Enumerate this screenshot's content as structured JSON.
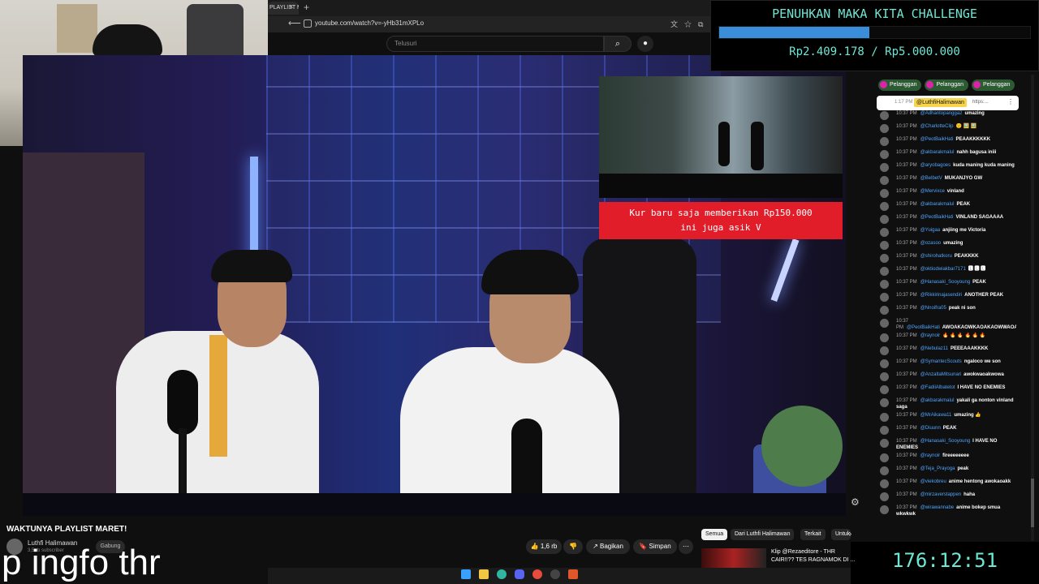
{
  "browser": {
    "tab_label": "PLAYLIST M",
    "tab_close": "×",
    "new_tab": "+",
    "url": "youtube.com/watch?v=-yHb31mXPLo",
    "icons": [
      "translate-icon",
      "star-icon",
      "extensions-icon"
    ]
  },
  "youtube": {
    "search_placeholder": "Telusuri",
    "search_icon": "⌕",
    "mic_icon": "🎤"
  },
  "challenge": {
    "title": "PENUHKAN MAKA KITA CHALLENGE",
    "progress_fraction": 0.4818,
    "amount": "Rp2.409.178 / Rp5.000.000",
    "bar_color": "#3a8ed9",
    "text_color": "#6ee7d4"
  },
  "donation": {
    "line1": "Kur baru saja memberikan Rp150.000",
    "line2": "ini juga asik V",
    "bg_color": "#e21d2a"
  },
  "chat": {
    "sub_buttons": [
      "Pelanggan",
      "Pelanggan",
      "Pelanggan"
    ],
    "pinned": {
      "time": "1:17 PM",
      "user": "@LuthfiHalimawan",
      "text": "https:..."
    },
    "messages": [
      {
        "time": "10:37 PM",
        "user": "@Adhantopangga2",
        "text": "umazing"
      },
      {
        "time": "10:37 PM",
        "user": "@CharlotteClip",
        "text": "🙂 🖼️ 🖼️"
      },
      {
        "time": "10:37 PM",
        "user": "@PeotBaikHati",
        "text": "PEAAKKKKKK"
      },
      {
        "time": "10:37 PM",
        "user": "@akbarakmalul",
        "text": "nahh bagusa iniii"
      },
      {
        "time": "10:37 PM",
        "user": "@aryobagoes",
        "text": "kuda maning kuda maning"
      },
      {
        "time": "10:37 PM",
        "user": "@BelbetV",
        "text": "MUKANJYO GW"
      },
      {
        "time": "10:37 PM",
        "user": "@Mervixce",
        "text": "vinland"
      },
      {
        "time": "10:37 PM",
        "user": "@akbarakmalul",
        "text": "PEAK"
      },
      {
        "time": "10:37 PM",
        "user": "@PeotBaikHati",
        "text": "VINLAND SAGAAAA"
      },
      {
        "time": "10:37 PM",
        "user": "@Yuigaa",
        "text": "anjiing me Victoria"
      },
      {
        "time": "10:37 PM",
        "user": "@ozasoo",
        "text": "umazing"
      },
      {
        "time": "10:37 PM",
        "user": "@shirohatkoru",
        "text": "PEAKKKK"
      },
      {
        "time": "10:37 PM",
        "user": "@oktiodwiakbar7171",
        "text": "🅻 🅻 🅻"
      },
      {
        "time": "10:37 PM",
        "user": "@Hanasaki_Sooyoung",
        "text": "PEAK"
      },
      {
        "time": "10:37 PM",
        "user": "@Rikkirinajasendiri",
        "text": "ANOTHER PEAK"
      },
      {
        "time": "10:37 PM",
        "user": "@Nnoifra05",
        "text": "peak ni son"
      },
      {
        "time": "10:37 PM",
        "user": "@PeotBaikHati",
        "text": "AWOAKAOWKAOAKAOWWAOAKAOAKA"
      },
      {
        "time": "10:37 PM",
        "user": "@raynoir",
        "text": "🔥 🔥 🔥 🔥 🔥 🔥"
      },
      {
        "time": "10:37 PM",
        "user": "@Nebulaz11",
        "text": "PEEEAAAKKKK"
      },
      {
        "time": "10:37 PM",
        "user": "@SymantecScouts",
        "text": "ngaloco we son"
      },
      {
        "time": "10:37 PM",
        "user": "@AnzaltaMitsunari",
        "text": "awokwaoakwowa"
      },
      {
        "time": "10:37 PM",
        "user": "@FadilAlbatetot",
        "text": "I HAVE NO ENEMIES"
      },
      {
        "time": "10:37 PM",
        "user": "@akbarakmalul",
        "text": "yakali ga nonton vinland saga"
      },
      {
        "time": "10:37 PM",
        "user": "@MrAikawa11",
        "text": "umazing 👍"
      },
      {
        "time": "10:37 PM",
        "user": "@Diuunn",
        "text": "PEAK"
      },
      {
        "time": "10:37 PM",
        "user": "@Hanasaki_Sooyoung",
        "text": "I HAVE NO ENEMIES"
      },
      {
        "time": "10:37 PM",
        "user": "@raynoir",
        "text": "fireeeeeeee"
      },
      {
        "time": "10:37 PM",
        "user": "@Teja_Prayoga",
        "text": "peak"
      },
      {
        "time": "10:37 PM",
        "user": "@viekobreu",
        "text": "anime hentong awokaoakk"
      },
      {
        "time": "10:37 PM",
        "user": "@mirzaverstappen",
        "text": "haha"
      },
      {
        "time": "10:37 PM",
        "user": "@wirawannabe",
        "text": "anime bokep smua wkwkwk"
      }
    ]
  },
  "timer": "176:12:51",
  "video": {
    "title": "WAKTUNYA PLAYLIST MARET!",
    "channel": "Luthfi Halimawan",
    "subs": "3,5 rb subscriber",
    "join": "Gabung",
    "overlay_text": "p ingfo thr",
    "like_count": "1,6 rb",
    "share": "Bagikan",
    "save": "Simpan",
    "more": "⋯"
  },
  "recommendations": {
    "chips": [
      "Semua",
      "Dari Luthfi Halimawan",
      "Terkait",
      "Untuk"
    ],
    "next_icon": "›",
    "item_title_line1": "Klip @Rezaeditore - THR",
    "item_title_line2": "CAIR!!?? TES RAGNAMOK DI ..."
  },
  "taskbar": {
    "icons": [
      "windows-start-icon",
      "file-explorer-icon",
      "edge-icon",
      "chrome-icon",
      "discord-icon",
      "obs-icon",
      "steam-icon",
      "brave-icon"
    ]
  }
}
